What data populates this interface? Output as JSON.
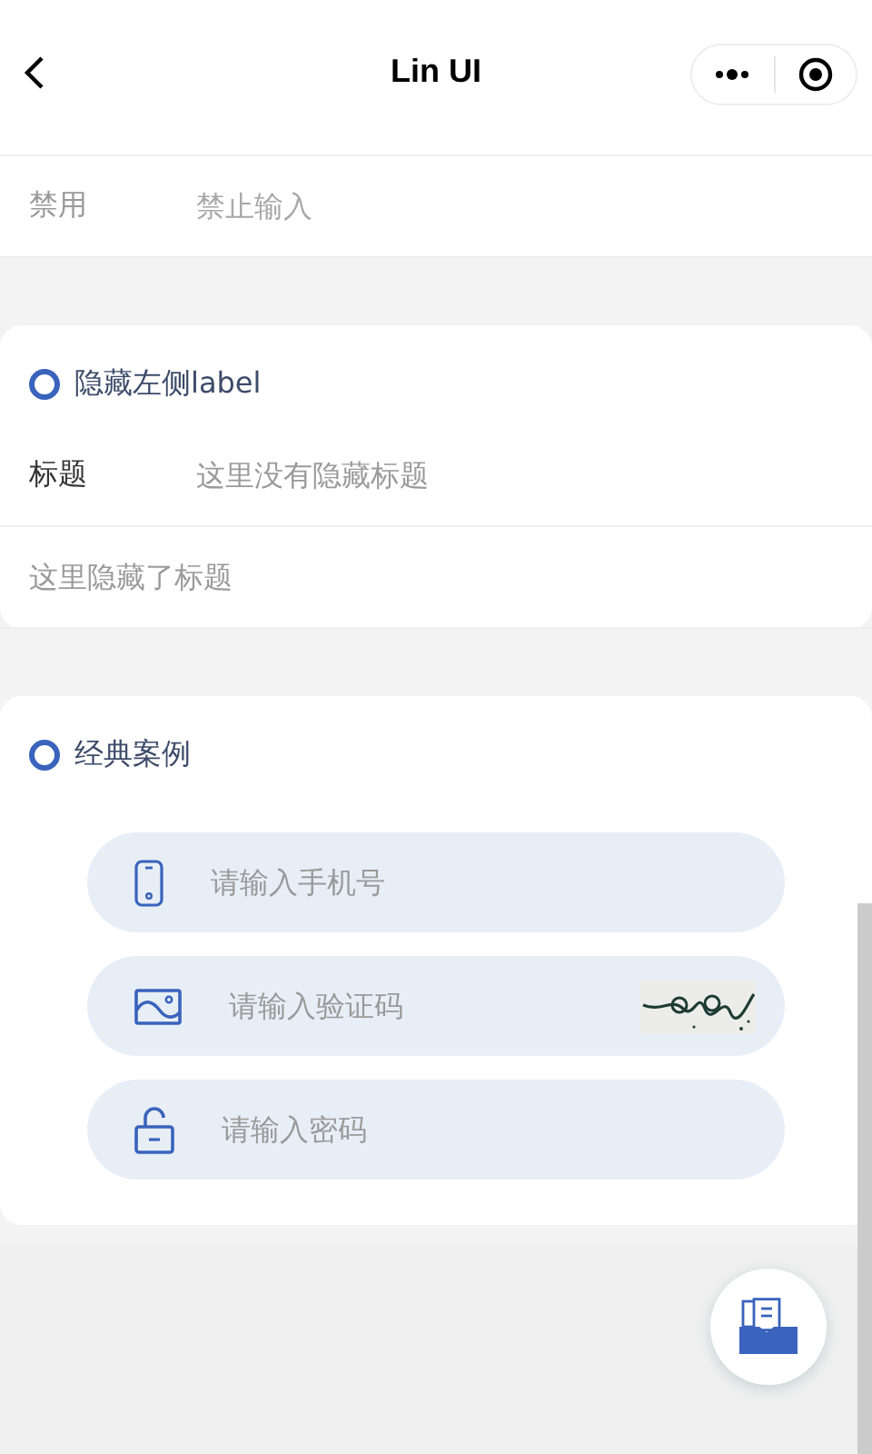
{
  "nav": {
    "title": "Lin UI"
  },
  "sections": [
    {
      "rows": [
        {
          "label": "禁用",
          "placeholder": "禁止输入",
          "disabled": true
        }
      ]
    },
    {
      "title": "隐藏左侧label",
      "rows": [
        {
          "label": "标题",
          "placeholder": "这里没有隐藏标题",
          "disabled": false
        },
        {
          "placeholder": "这里隐藏了标题",
          "disabled": false
        }
      ]
    }
  ],
  "classic": {
    "title": "经典案例",
    "fields": [
      {
        "kind": "phone",
        "placeholder": "请输入手机号"
      },
      {
        "kind": "captcha",
        "placeholder": "请输入验证码"
      },
      {
        "kind": "password",
        "placeholder": "请输入密码"
      }
    ]
  }
}
